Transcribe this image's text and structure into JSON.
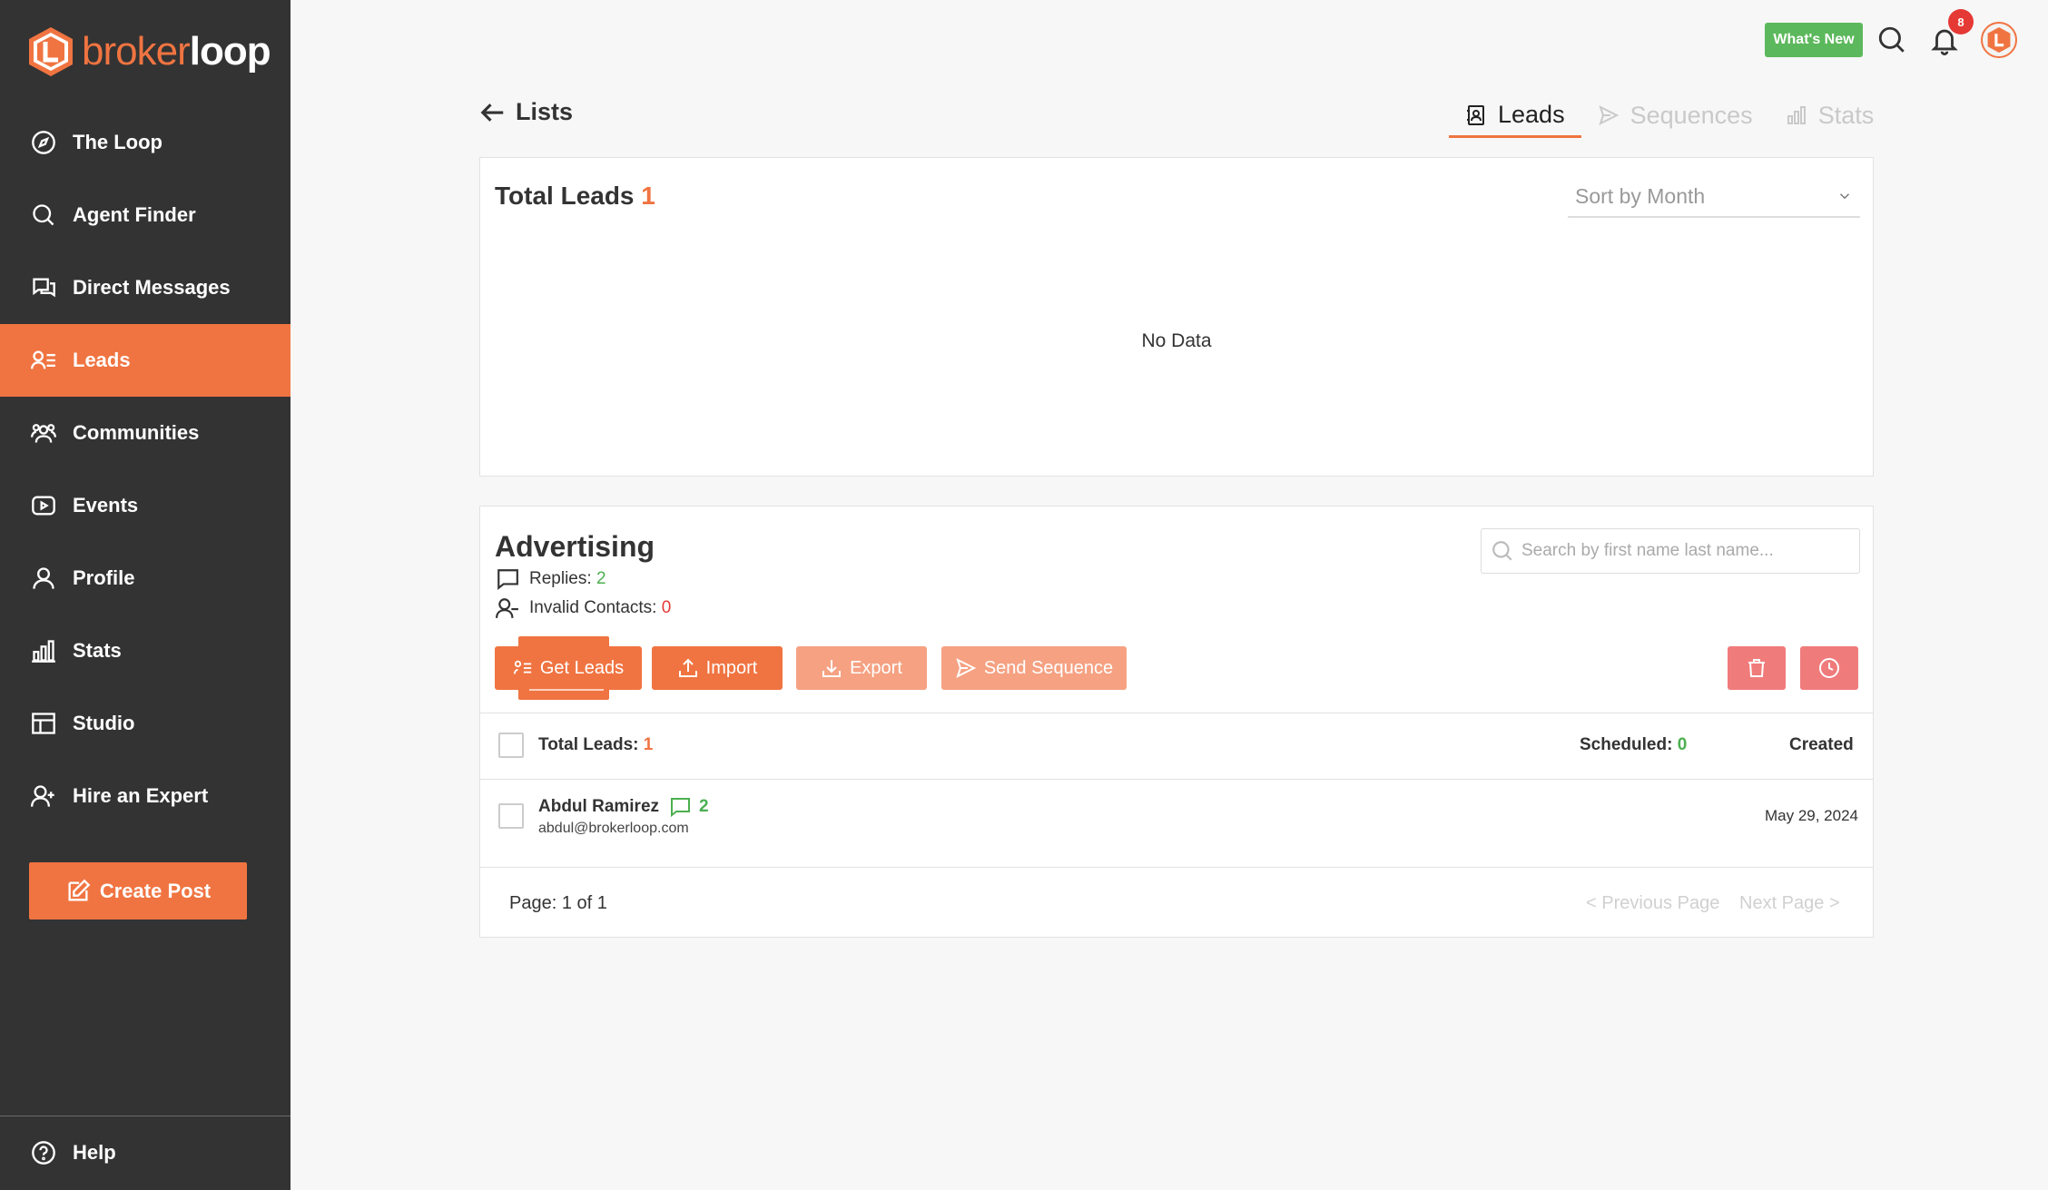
{
  "brand": {
    "part1": "broker",
    "part2": "loop"
  },
  "sidebar": {
    "items": [
      {
        "label": "The Loop",
        "icon": "compass-icon"
      },
      {
        "label": "Agent Finder",
        "icon": "search-icon"
      },
      {
        "label": "Direct Messages",
        "icon": "chat-icon"
      },
      {
        "label": "Leads",
        "icon": "leads-list-icon",
        "active": true
      },
      {
        "label": "Communities",
        "icon": "users-icon"
      },
      {
        "label": "Events",
        "icon": "video-icon"
      },
      {
        "label": "Profile",
        "icon": "user-icon"
      },
      {
        "label": "Stats",
        "icon": "bar-chart-icon"
      },
      {
        "label": "Studio",
        "icon": "layout-icon"
      },
      {
        "label": "Hire an Expert",
        "icon": "user-plus-icon"
      }
    ],
    "create_post": "Create Post",
    "help": "Help"
  },
  "topbar": {
    "whats_new": "What's New",
    "notifications_count": "8"
  },
  "header": {
    "back_label": "Lists",
    "tabs": [
      {
        "label": "Leads",
        "active": true
      },
      {
        "label": "Sequences"
      },
      {
        "label": "Stats"
      }
    ]
  },
  "summary": {
    "title": "Total Leads",
    "count": "1",
    "sort_value": "Sort by Month",
    "empty_text": "No Data"
  },
  "list": {
    "title": "Advertising",
    "replies_label": "Replies:",
    "replies_value": "2",
    "invalid_label": "Invalid Contacts:",
    "invalid_value": "0",
    "search_placeholder": "Search by first name last name...",
    "buttons": {
      "get_leads": "Get Leads",
      "import": "Import",
      "export": "Export",
      "send_sequence": "Send Sequence"
    },
    "table": {
      "total_label": "Total Leads:",
      "total_value": "1",
      "scheduled_label": "Scheduled:",
      "scheduled_value": "0",
      "created_label": "Created",
      "rows": [
        {
          "name": "Abdul Ramirez",
          "replies": "2",
          "email": "abdul@brokerloop.com",
          "created": "May 29, 2024"
        }
      ]
    },
    "pagination": {
      "page_info": "Page: 1 of 1",
      "previous": "< Previous Page",
      "next": "Next Page >"
    }
  },
  "colors": {
    "accent": "#f07441",
    "sidebar": "#333333",
    "success": "#4caf50",
    "danger": "#e53935"
  }
}
